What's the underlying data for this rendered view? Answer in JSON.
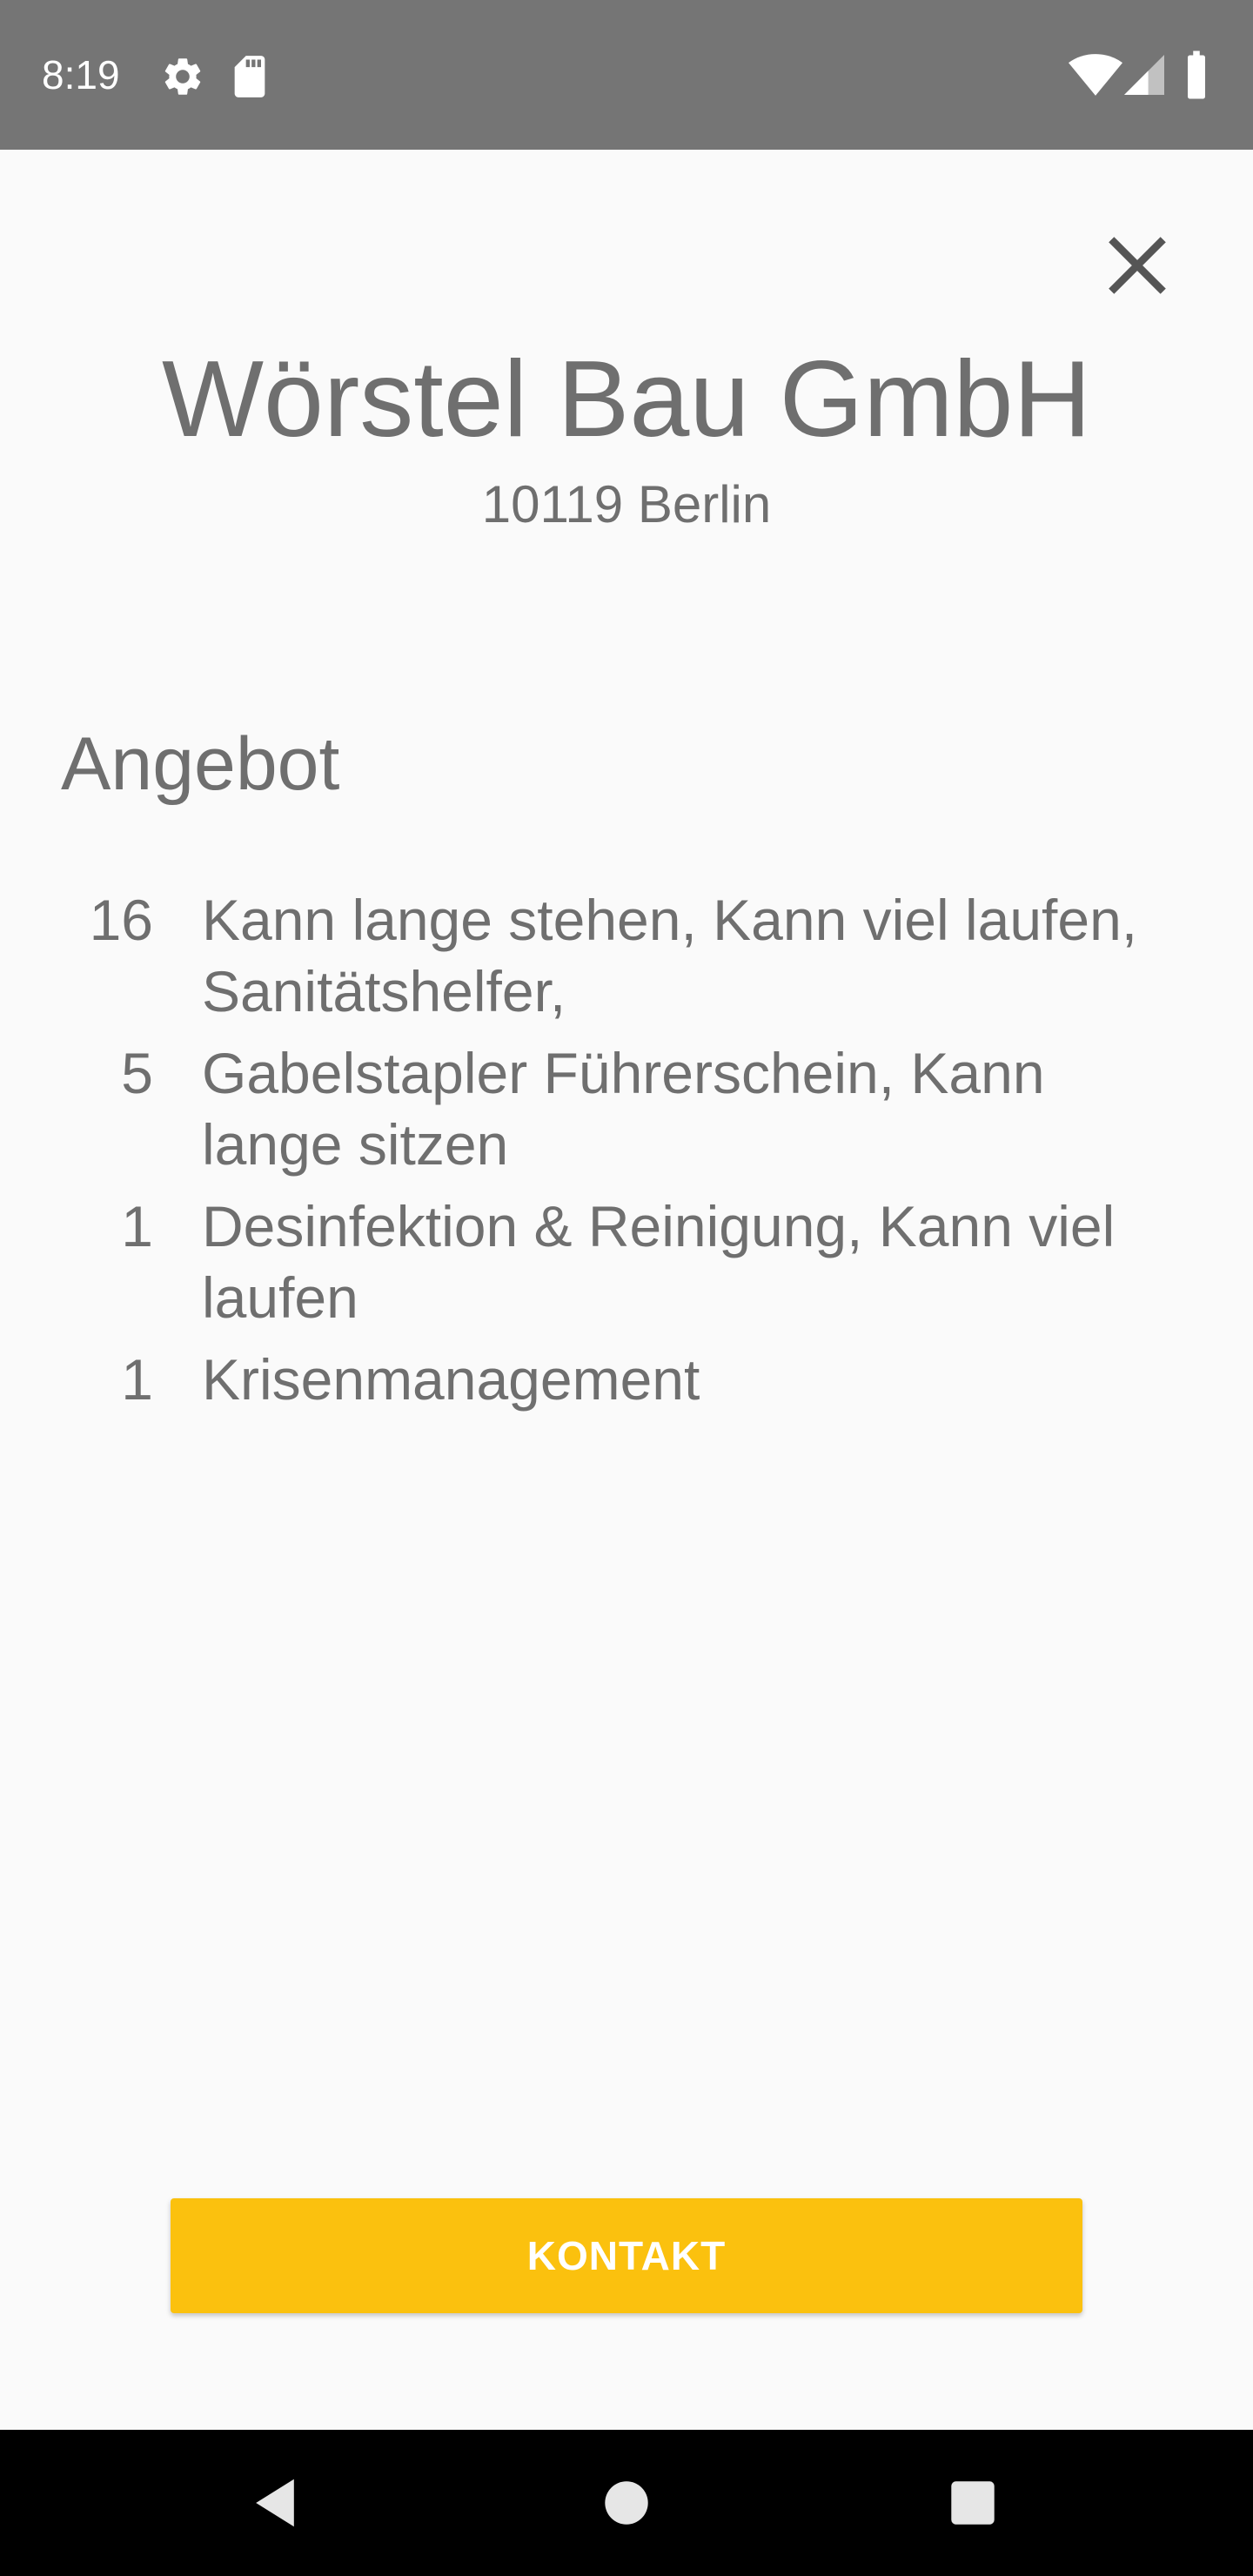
{
  "status_bar": {
    "time": "8:19",
    "background": "#757575",
    "icons": [
      "gear-icon",
      "sd-card-icon",
      "wifi-icon",
      "cell-signal-icon",
      "battery-icon"
    ]
  },
  "header": {
    "company_name": "Wörstel Bau GmbH",
    "location": "10119 Berlin",
    "close_icon": "close-icon"
  },
  "offer": {
    "title": "Angebot",
    "items": [
      {
        "count": "16",
        "text": "Kann lange stehen, Kann viel laufen, Sanitätshelfer,"
      },
      {
        "count": "5",
        "text": "Gabelstapler Führerschein, Kann lange sitzen"
      },
      {
        "count": "1",
        "text": "Desinfektion & Reinigung, Kann viel laufen"
      },
      {
        "count": "1",
        "text": "Krisenmanagement"
      }
    ]
  },
  "contact_button": {
    "label": "KONTAKT",
    "color": "#fbc10e"
  },
  "nav_bar": {
    "icons": [
      "back-icon",
      "home-icon",
      "recents-icon"
    ]
  },
  "colors": {
    "text": "#6f6f6f",
    "background": "#fafafa"
  }
}
